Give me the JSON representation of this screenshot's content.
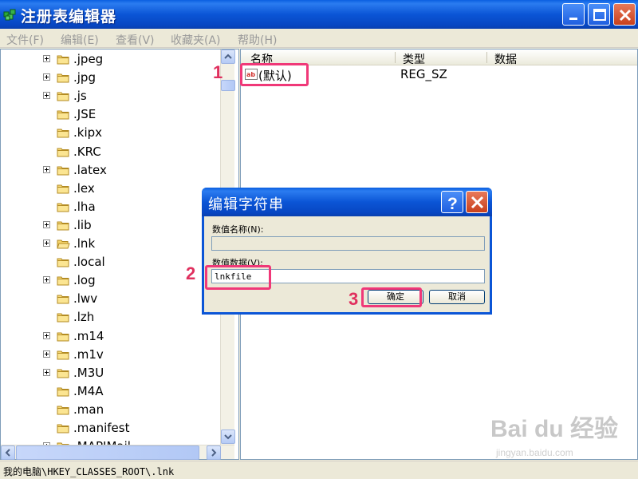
{
  "window": {
    "title": "注册表编辑器"
  },
  "menu": [
    "文件(F)",
    "编辑(E)",
    "查看(V)",
    "收藏夹(A)",
    "帮助(H)"
  ],
  "tree": {
    "items": [
      {
        "label": ".jpeg",
        "expandable": true
      },
      {
        "label": ".jpg",
        "expandable": true
      },
      {
        "label": ".js",
        "expandable": true
      },
      {
        "label": ".JSE",
        "expandable": false
      },
      {
        "label": ".kipx",
        "expandable": false
      },
      {
        "label": ".KRC",
        "expandable": false
      },
      {
        "label": ".latex",
        "expandable": true
      },
      {
        "label": ".lex",
        "expandable": false
      },
      {
        "label": ".lha",
        "expandable": false
      },
      {
        "label": ".lib",
        "expandable": true
      },
      {
        "label": ".lnk",
        "expandable": true,
        "selected": true
      },
      {
        "label": ".local",
        "expandable": false
      },
      {
        "label": ".log",
        "expandable": true
      },
      {
        "label": ".lwv",
        "expandable": false
      },
      {
        "label": ".lzh",
        "expandable": false
      },
      {
        "label": ".m14",
        "expandable": true
      },
      {
        "label": ".m1v",
        "expandable": true
      },
      {
        "label": ".M3U",
        "expandable": true
      },
      {
        "label": ".M4A",
        "expandable": false
      },
      {
        "label": ".man",
        "expandable": false
      },
      {
        "label": ".manifest",
        "expandable": false
      },
      {
        "label": ".MAPIMail",
        "expandable": true
      }
    ]
  },
  "list": {
    "columns": [
      "名称",
      "类型",
      "数据"
    ],
    "rows": [
      {
        "name": "(默认)",
        "type": "REG_SZ",
        "data": ""
      }
    ]
  },
  "status": {
    "path": "我的电脑\\HKEY_CLASSES_ROOT\\.lnk"
  },
  "dialog": {
    "title": "编辑字符串",
    "value_name_label": "数值名称(N):",
    "value_name": "",
    "value_data_label": "数值数据(V):",
    "value_data": "lnkfile",
    "ok_label": "确定",
    "cancel_label": "取消"
  },
  "annotations": [
    "1",
    "2",
    "3"
  ],
  "watermark": {
    "text": "Bai du 经验",
    "sub": "jingyan.baidu.com"
  },
  "colors": {
    "titlebar": "#0b55d6",
    "highlight": "#f03878",
    "annotation_text": "#e0305e",
    "menu_text": "#9a9a9a"
  }
}
